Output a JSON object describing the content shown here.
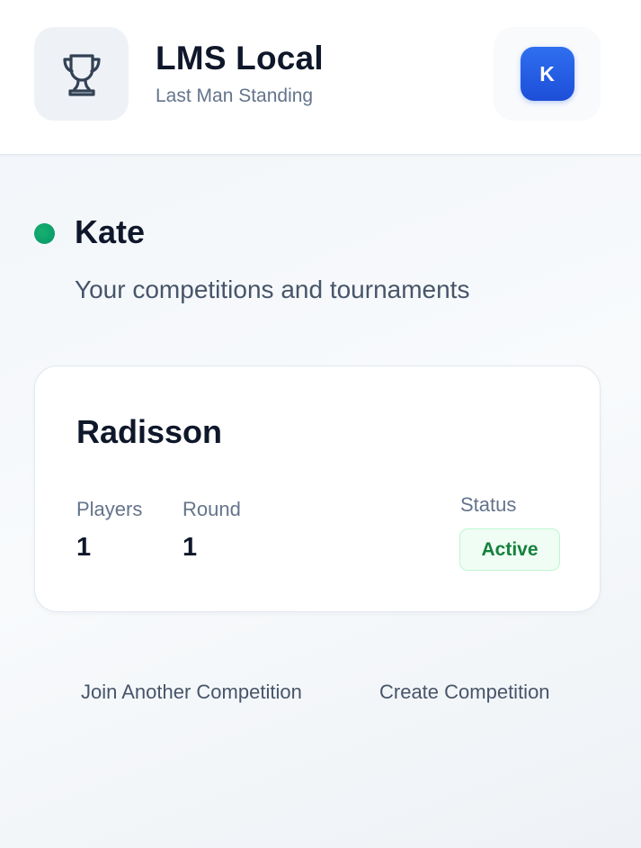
{
  "header": {
    "logo_icon": "trophy-icon",
    "title": "LMS Local",
    "subtitle": "Last Man Standing",
    "avatar_initial": "K"
  },
  "welcome": {
    "status_dot_color": "#059669",
    "name": "Kate",
    "subtitle": "Your competitions and tournaments"
  },
  "competition": {
    "name": "Radisson",
    "players_label": "Players",
    "players_value": "1",
    "round_label": "Round",
    "round_value": "1",
    "status_label": "Status",
    "status_value": "Active"
  },
  "actions": {
    "join_label": "Join Another Competition",
    "create_label": "Create Competition"
  },
  "colors": {
    "accent": "#2563eb",
    "status_active": "#15803d",
    "online": "#059669"
  }
}
